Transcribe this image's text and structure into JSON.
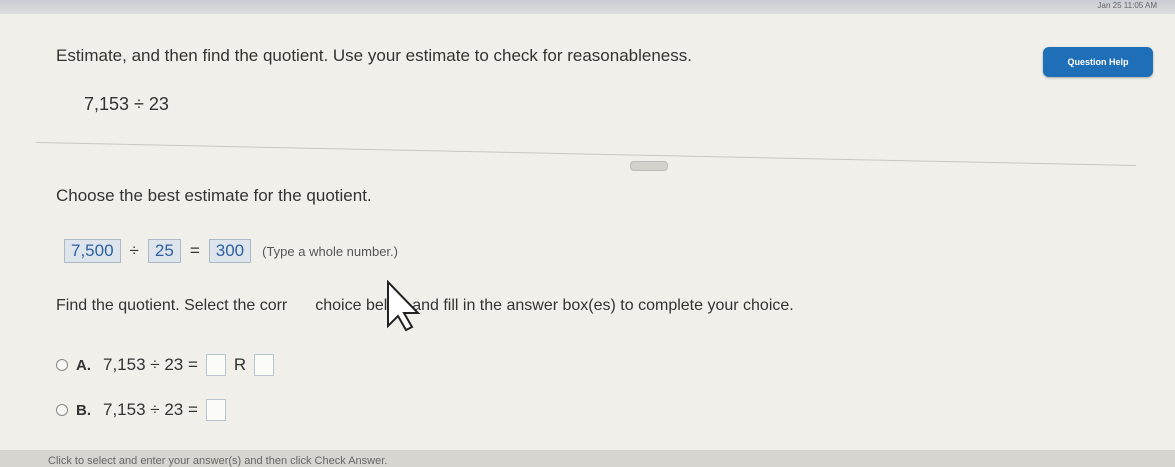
{
  "window": {
    "header_meta": "Jan 25 11:05 AM"
  },
  "help_button": {
    "label": "Question Help",
    "color": "#1f6fb8"
  },
  "question": {
    "prompt": "Estimate, and then find the quotient. Use your estimate to check for reasonableness.",
    "problem": "7,153 ÷ 23"
  },
  "part1": {
    "instruction": "Choose the best estimate for the quotient.",
    "dividend_estimate": "7,500",
    "divide_sign": "÷",
    "divisor_estimate": "25",
    "equals_sign": "=",
    "quotient_estimate": "300",
    "hint": "(Type a whole number.)"
  },
  "part2": {
    "instruction": "Find the quotient. Select the correct choice below and fill in the answer box(es) to complete your choice.",
    "instruction_visible_prefix": "Find the quotient. Select the corr",
    "instruction_visible_suffix": "choice below and fill in the answer box(es) to complete your choice.",
    "choices": [
      {
        "letter": "A.",
        "expression": "7,153 ÷ 23 =",
        "remainder_label": "R"
      },
      {
        "letter": "B.",
        "expression": "7,153 ÷ 23 ="
      }
    ]
  },
  "footer": {
    "text": "Click to select and enter your answer(s) and then click Check Answer."
  }
}
